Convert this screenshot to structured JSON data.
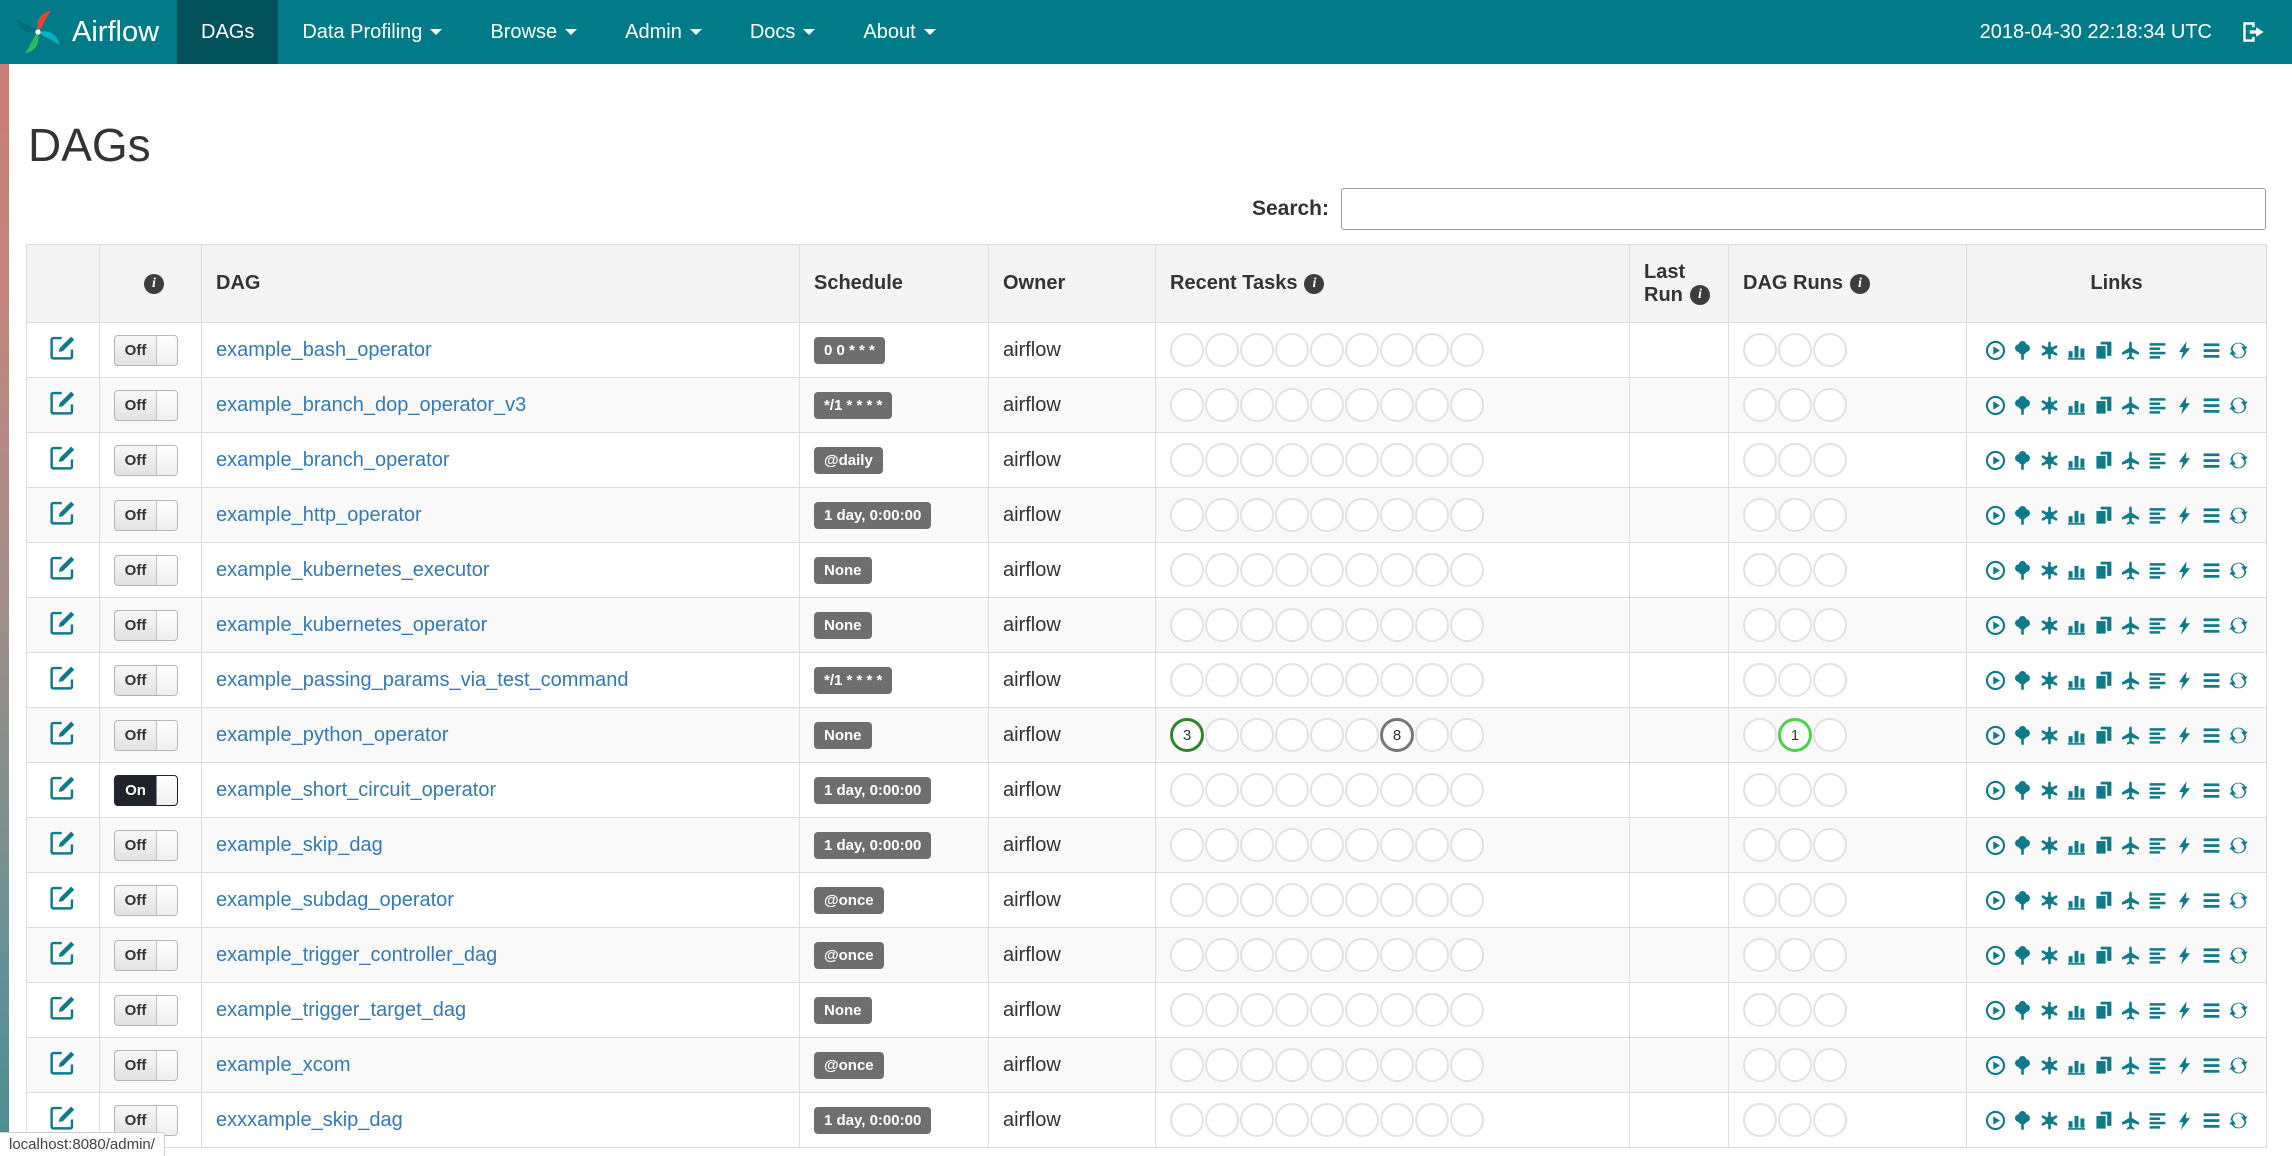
{
  "navbar": {
    "brand": "Airflow",
    "items": [
      {
        "label": "DAGs",
        "active": true,
        "caret": false
      },
      {
        "label": "Data Profiling",
        "active": false,
        "caret": true
      },
      {
        "label": "Browse",
        "active": false,
        "caret": true
      },
      {
        "label": "Admin",
        "active": false,
        "caret": true
      },
      {
        "label": "Docs",
        "active": false,
        "caret": true
      },
      {
        "label": "About",
        "active": false,
        "caret": true
      }
    ],
    "clock": "2018-04-30 22:18:34 UTC"
  },
  "page": {
    "title": "DAGs",
    "status_bar": "localhost:8080/admin/"
  },
  "search": {
    "label": "Search:",
    "value": ""
  },
  "colors": {
    "navbar_bg": "#017b87",
    "navbar_active_bg": "#02525c",
    "accent_teal": "#0e7a8a",
    "link_blue": "#337ab7",
    "badge_gray": "#6e6e6e",
    "state_colors": {
      "success": "#2d862d",
      "queued": "#777777",
      "running": "#4bd14b"
    }
  },
  "table": {
    "headers": {
      "dag": "DAG",
      "schedule": "Schedule",
      "owner": "Owner",
      "recent_tasks": "Recent Tasks",
      "last_run": "Last Run",
      "dag_runs": "DAG Runs",
      "links": "Links"
    },
    "links": [
      "trigger-dag-icon",
      "tree-view-icon",
      "graph-view-icon",
      "tasks-duration-icon",
      "task-tries-icon",
      "landing-times-icon",
      "gantt-view-icon",
      "code-view-icon",
      "logs-icon",
      "refresh-icon"
    ],
    "rows": [
      {
        "dag": "example_bash_operator",
        "toggle": "Off",
        "schedule": "0 0 * * *",
        "owner": "airflow",
        "recent_tasks": [],
        "dag_runs": []
      },
      {
        "dag": "example_branch_dop_operator_v3",
        "toggle": "Off",
        "schedule": "*/1 * * * *",
        "owner": "airflow",
        "recent_tasks": [],
        "dag_runs": []
      },
      {
        "dag": "example_branch_operator",
        "toggle": "Off",
        "schedule": "@daily",
        "owner": "airflow",
        "recent_tasks": [],
        "dag_runs": []
      },
      {
        "dag": "example_http_operator",
        "toggle": "Off",
        "schedule": "1 day, 0:00:00",
        "owner": "airflow",
        "recent_tasks": [],
        "dag_runs": []
      },
      {
        "dag": "example_kubernetes_executor",
        "toggle": "Off",
        "schedule": "None",
        "owner": "airflow",
        "recent_tasks": [],
        "dag_runs": []
      },
      {
        "dag": "example_kubernetes_operator",
        "toggle": "Off",
        "schedule": "None",
        "owner": "airflow",
        "recent_tasks": [],
        "dag_runs": []
      },
      {
        "dag": "example_passing_params_via_test_command",
        "toggle": "Off",
        "schedule": "*/1 * * * *",
        "owner": "airflow",
        "recent_tasks": [],
        "dag_runs": []
      },
      {
        "dag": "example_python_operator",
        "toggle": "Off",
        "schedule": "None",
        "owner": "airflow",
        "recent_tasks": [
          {
            "slot": 0,
            "count": "3",
            "color_key": "success"
          },
          {
            "slot": 6,
            "count": "8",
            "color_key": "queued"
          }
        ],
        "dag_runs": [
          {
            "slot": 1,
            "count": "1",
            "color_key": "running"
          }
        ]
      },
      {
        "dag": "example_short_circuit_operator",
        "toggle": "On",
        "schedule": "1 day, 0:00:00",
        "owner": "airflow",
        "recent_tasks": [],
        "dag_runs": []
      },
      {
        "dag": "example_skip_dag",
        "toggle": "Off",
        "schedule": "1 day, 0:00:00",
        "owner": "airflow",
        "recent_tasks": [],
        "dag_runs": []
      },
      {
        "dag": "example_subdag_operator",
        "toggle": "Off",
        "schedule": "@once",
        "owner": "airflow",
        "recent_tasks": [],
        "dag_runs": []
      },
      {
        "dag": "example_trigger_controller_dag",
        "toggle": "Off",
        "schedule": "@once",
        "owner": "airflow",
        "recent_tasks": [],
        "dag_runs": []
      },
      {
        "dag": "example_trigger_target_dag",
        "toggle": "Off",
        "schedule": "None",
        "owner": "airflow",
        "recent_tasks": [],
        "dag_runs": []
      },
      {
        "dag": "example_xcom",
        "toggle": "Off",
        "schedule": "@once",
        "owner": "airflow",
        "recent_tasks": [],
        "dag_runs": []
      },
      {
        "dag": "exxxample_skip_dag",
        "toggle": "Off",
        "schedule": "1 day, 0:00:00",
        "owner": "airflow",
        "recent_tasks": [],
        "dag_runs": []
      }
    ]
  }
}
